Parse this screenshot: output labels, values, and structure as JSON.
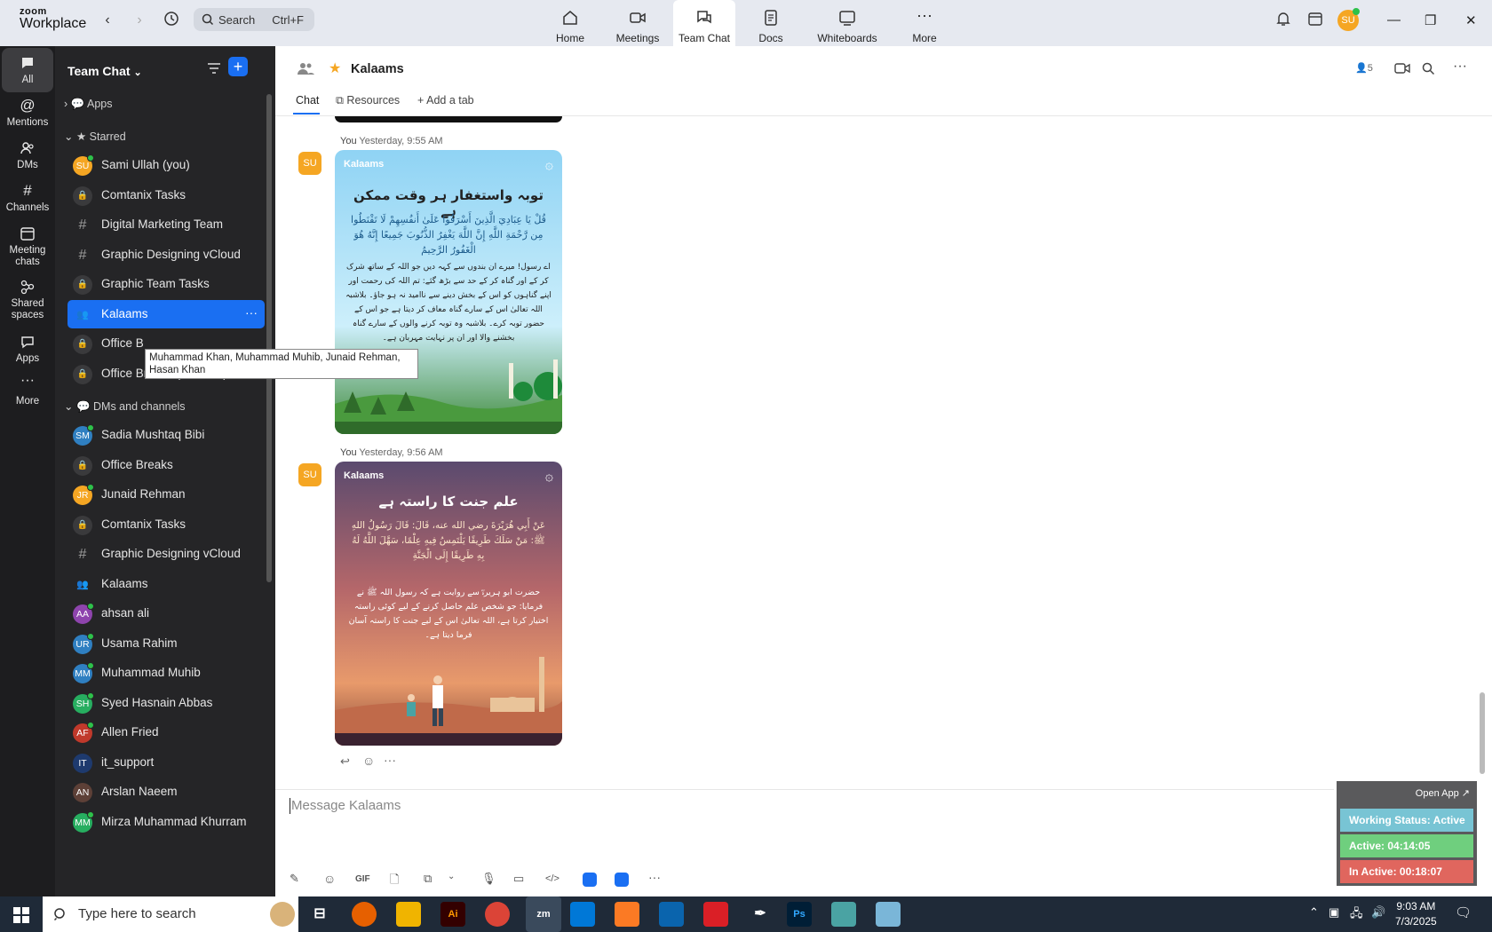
{
  "app": {
    "brand_top": "zoom",
    "brand_bottom": "Workplace"
  },
  "search": {
    "label": "Search",
    "shortcut": "Ctrl+F"
  },
  "nav_tabs": [
    {
      "label": "Home",
      "icon": "home-icon"
    },
    {
      "label": "Meetings",
      "icon": "video-icon"
    },
    {
      "label": "Team Chat",
      "icon": "chat-icon",
      "active": true
    },
    {
      "label": "Docs",
      "icon": "doc-icon"
    },
    {
      "label": "Whiteboards",
      "icon": "whiteboard-icon"
    },
    {
      "label": "More",
      "icon": "more-icon"
    }
  ],
  "header_avatar": "SU",
  "rail": [
    {
      "label": "All",
      "icon": "chat-icon",
      "active": true
    },
    {
      "label": "Mentions",
      "icon": "at-icon"
    },
    {
      "label": "DMs",
      "icon": "people-icon"
    },
    {
      "label": "Channels",
      "icon": "hash-icon"
    },
    {
      "label": "Meeting chats",
      "icon": "calendar-icon"
    },
    {
      "label": "Shared spaces",
      "icon": "share-icon"
    },
    {
      "label": "Apps",
      "icon": "apps-icon"
    },
    {
      "label": "More",
      "icon": "more-icon"
    }
  ],
  "sidebar": {
    "title": "Team Chat",
    "sections": {
      "apps": "Apps",
      "starred": "Starred",
      "dms": "DMs and channels"
    },
    "starred": [
      {
        "name": "Sami Ullah (you)",
        "initials": "SU",
        "color": "#f5a623",
        "online": true
      },
      {
        "name": "Comtanix Tasks",
        "type": "lock"
      },
      {
        "name": "Digital Marketing Team",
        "type": "hash"
      },
      {
        "name": "Graphic Designing vCloud",
        "type": "hash"
      },
      {
        "name": "Graphic Team Tasks",
        "type": "lock"
      },
      {
        "name": "Kalaams",
        "type": "group",
        "selected": true
      },
      {
        "name": "Office B",
        "type": "lock"
      },
      {
        "name": "Office Breaks (IT Team)",
        "type": "lock"
      }
    ],
    "dms": [
      {
        "name": "Sadia Mushtaq Bibi",
        "initials": "SM",
        "color": "#2f7fc1",
        "online": true
      },
      {
        "name": "Office Breaks",
        "type": "lock"
      },
      {
        "name": "Junaid Rehman",
        "initials": "JR",
        "color": "#f5a623",
        "online": true
      },
      {
        "name": "Comtanix Tasks",
        "type": "lock"
      },
      {
        "name": "Graphic Designing vCloud",
        "type": "hash"
      },
      {
        "name": "Kalaams",
        "type": "group"
      },
      {
        "name": "ahsan ali",
        "initials": "AA",
        "color": "#8e44ad",
        "online": true
      },
      {
        "name": "Usama Rahim",
        "initials": "UR",
        "color": "#2f7fc1",
        "online": true
      },
      {
        "name": "Muhammad Muhib",
        "initials": "MM",
        "color": "#2f7fc1",
        "online": true
      },
      {
        "name": "Syed Hasnain Abbas",
        "initials": "SH",
        "color": "#27ae60",
        "online": true
      },
      {
        "name": "Allen Fried",
        "initials": "AF",
        "color": "#c0392b",
        "online": true
      },
      {
        "name": "it_support",
        "initials": "IT",
        "color": "#1e3a6e"
      },
      {
        "name": "Arslan Naeem",
        "initials": "AN",
        "color": "#5d4037"
      },
      {
        "name": "Mirza Muhammad Khurram",
        "initials": "MM",
        "color": "#27ae60",
        "online": true
      }
    ],
    "tooltip": "Muhammad Khan, Muhammad Muhib, Junaid Rehman, Hasan Khan"
  },
  "channel": {
    "name": "Kalaams",
    "member_count": "5",
    "tabs": {
      "chat": "Chat",
      "resources": "Resources",
      "add": "Add a tab"
    }
  },
  "messages": [
    {
      "sender": "You",
      "time": "Yesterday, 9:55 AM",
      "avatar": "SU",
      "card": {
        "logo": "Kalaams",
        "heading": "توبہ واستغفار ہر وقت ممکن ہے",
        "verse": "قُلْ يَا عِبَادِيَ الَّذِينَ أَسْرَفُوا عَلَىٰ أَنفُسِهِمْ لَا تَقْنَطُوا مِن رَّحْمَةِ اللَّهِ إِنَّ اللَّهَ يَغْفِرُ الذُّنُوبَ جَمِيعًا إِنَّهُ هُوَ الْغَفُورُ الرَّحِيمُ",
        "text": "اے رسول! میرے ان بندوں سے کہہ دیں جو اللہ کے ساتھ شرک کر کے اور گناہ کر کے حد سے بڑھ گئے: تم اللہ کی رحمت اور اپنے گناہوں کو اس کے بخش دینے سے ناامید نہ ہو جاؤ۔ بلاشبہ اللہ تعالیٰ اس کے سارے گناہ معاف کر دیتا ہے جو اس کے حضور توبہ کرے۔ بلاشبہ وہ توبہ کرنے والوں کے سارے گناہ بخشنے والا اور ان پر نہایت مہربان ہے۔"
      }
    },
    {
      "sender": "You",
      "time": "Yesterday, 9:56 AM",
      "avatar": "SU",
      "card": {
        "logo": "Kalaams",
        "heading": "علم جنت کا راستہ ہے",
        "verse": "عَنْ أَبِي هُرَيْرَةَ رضي الله عنه، قَالَ: قَالَ رَسُولُ اللهِ ﷺ: مَنْ سَلَكَ طَرِيقًا يَلْتَمِسُ فِيهِ عِلْمًا، سَهَّلَ اللَّهُ لَهُ بِهِ طَرِيقًا إِلَى الْجَنَّةِ",
        "text": "حضرت ابو ہریرہؓ سے روایت ہے کہ رسول اللہ ﷺ نے فرمایا: جو شخص علم حاصل کرنے کے لیے کوئی راستہ اختیار کرتا ہے، اللہ تعالیٰ اس کے لیے جنت کا راستہ آسان فرما دیتا ہے۔"
      }
    }
  ],
  "composer": {
    "placeholder": "Message Kalaams",
    "gif": "GIF"
  },
  "widget": {
    "open_app": "Open App ↗",
    "status": "Working Status: Active",
    "active": "Active: 04:14:05",
    "inactive": "In Active: 00:18:07"
  },
  "taskbar": {
    "search": "Type here to search",
    "time": "9:03 AM",
    "date": "7/3/2025"
  }
}
